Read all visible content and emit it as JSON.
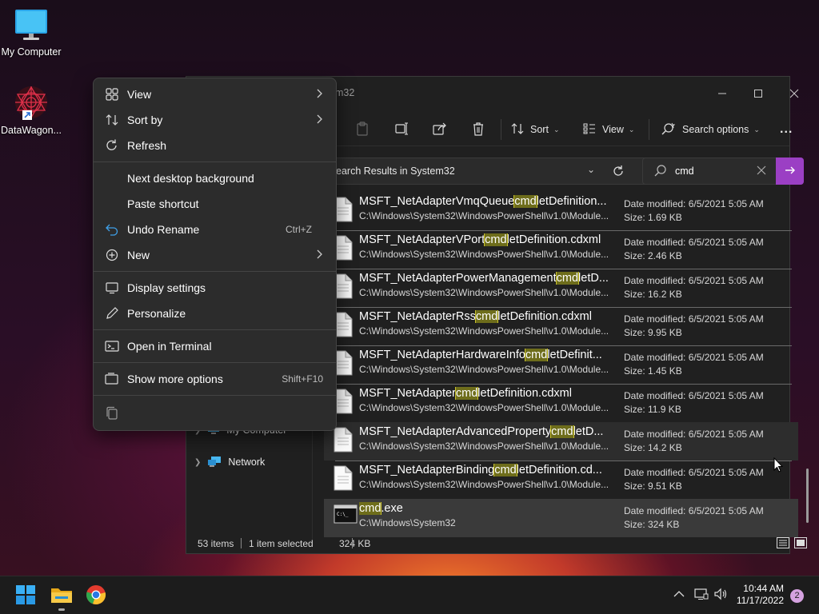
{
  "desktop": {
    "icons": [
      {
        "label": "My Computer",
        "icon": "monitor-icon"
      },
      {
        "label": "DataWagon...",
        "icon": "datawagon-logo-icon"
      }
    ]
  },
  "explorer": {
    "title_fragment": "m32",
    "toolbar": {
      "sort_label": "Sort",
      "view_label": "View",
      "search_options_label": "Search options",
      "more_label": "..."
    },
    "address": "earch Results in System32",
    "search": {
      "value": "cmd"
    },
    "nav": [
      {
        "label": "My Computer"
      },
      {
        "label": "Network"
      }
    ],
    "rows": [
      {
        "pre": "MSFT_NetAdapterVmqQueue",
        "hl": "cmd",
        "post": "letDefinition...",
        "path": "C:\\Windows\\System32\\WindowsPowerShell\\v1.0\\Module...",
        "date": "Date modified: 6/5/2021 5:05 AM",
        "size": "Size: 1.69 KB"
      },
      {
        "pre": "MSFT_NetAdapterVPort",
        "hl": "cmd",
        "post": "letDefinition.cdxml",
        "path": "C:\\Windows\\System32\\WindowsPowerShell\\v1.0\\Module...",
        "date": "Date modified: 6/5/2021 5:05 AM",
        "size": "Size: 2.46 KB"
      },
      {
        "pre": "MSFT_NetAdapterPowerManagement",
        "hl": "cmd",
        "post": "letD...",
        "path": "C:\\Windows\\System32\\WindowsPowerShell\\v1.0\\Module...",
        "date": "Date modified: 6/5/2021 5:05 AM",
        "size": "Size: 16.2 KB"
      },
      {
        "pre": "MSFT_NetAdapterRss",
        "hl": "cmd",
        "post": "letDefinition.cdxml",
        "path": "C:\\Windows\\System32\\WindowsPowerShell\\v1.0\\Module...",
        "date": "Date modified: 6/5/2021 5:05 AM",
        "size": "Size: 9.95 KB"
      },
      {
        "pre": "MSFT_NetAdapterHardwareInfo",
        "hl": "cmd",
        "post": "letDefinit...",
        "path": "C:\\Windows\\System32\\WindowsPowerShell\\v1.0\\Module...",
        "date": "Date modified: 6/5/2021 5:05 AM",
        "size": "Size: 1.45 KB"
      },
      {
        "pre": "MSFT_NetAdapter",
        "hl": "cmd",
        "post": "letDefinition.cdxml",
        "path": "C:\\Windows\\System32\\WindowsPowerShell\\v1.0\\Module...",
        "date": "Date modified: 6/5/2021 5:05 AM",
        "size": "Size: 11.9 KB"
      },
      {
        "pre": "MSFT_NetAdapterAdvancedProperty",
        "hl": "cmd",
        "post": "letD...",
        "path": "C:\\Windows\\System32\\WindowsPowerShell\\v1.0\\Module...",
        "date": "Date modified: 6/5/2021 5:05 AM",
        "size": "Size: 14.2 KB"
      },
      {
        "pre": "MSFT_NetAdapterBinding",
        "hl": "cmd",
        "post": "letDefinition.cd...",
        "path": "C:\\Windows\\System32\\WindowsPowerShell\\v1.0\\Module...",
        "date": "Date modified: 6/5/2021 5:05 AM",
        "size": "Size: 9.51 KB"
      },
      {
        "pre": "",
        "hl": "cmd",
        "post": ".exe",
        "path": "C:\\Windows\\System32",
        "date": "Date modified: 6/5/2021 5:05 AM",
        "size": "Size: 324 KB"
      }
    ],
    "status": {
      "items": "53 items",
      "selected": "1 item selected",
      "size": "324 KB"
    }
  },
  "context_menu": {
    "items": [
      {
        "label": "View",
        "icon": "grid-icon"
      },
      {
        "label": "Sort by",
        "icon": "sort-icon"
      },
      {
        "label": "Refresh",
        "icon": "refresh-icon"
      },
      {
        "label": "Next desktop background"
      },
      {
        "label": "Paste shortcut"
      },
      {
        "label": "Undo Rename",
        "icon": "undo-icon",
        "shortcut": "Ctrl+Z"
      },
      {
        "label": "New",
        "icon": "plus-circle-icon"
      },
      {
        "label": "Display settings",
        "icon": "display-icon"
      },
      {
        "label": "Personalize",
        "icon": "pen-icon"
      },
      {
        "label": "Open in Terminal",
        "icon": "terminal-icon"
      },
      {
        "label": "Show more options",
        "icon": "more-options-icon",
        "shortcut": "Shift+F10"
      }
    ]
  },
  "taskbar": {
    "time": "10:44 AM",
    "date": "11/17/2022",
    "notifications": "2"
  },
  "colors": {
    "highlight": "#6e6d1b",
    "search_go": "#9b3fc4",
    "selected_row": "#3a3a3a"
  }
}
